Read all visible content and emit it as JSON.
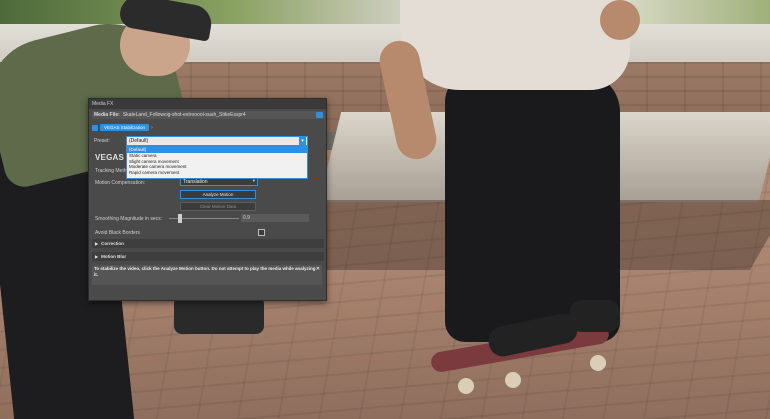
{
  "window": {
    "title": "Media FX",
    "media_file_label": "Media File:",
    "media_file_value": "SkateLand_Followcig-shot-extrooool-suuh_StikeEsspr4",
    "plugin_chain_button": "VEGAS Stabilization",
    "help_icon": "help-icon"
  },
  "preset": {
    "label": "Preset:",
    "selected": "(Default)",
    "options": [
      "(Default)",
      "Static camera",
      "Slight camera movement",
      "Moderate camera movement",
      "Rapid camera movement"
    ]
  },
  "plugin": {
    "logo": "VEGAS V",
    "tracking_label": "Tracking Meth",
    "motion_comp_label": "Motion Compensation:",
    "motion_comp_value": "Translation",
    "analyze_button": "Analyze Motion",
    "clear_button": "Clear Motion Data",
    "smoothing_label": "Smoothing Magnitude in secs:",
    "smoothing_value": "0.9",
    "smoothing_level": 0.15,
    "avoid_label": "Avoid Black Borders",
    "avoid_checked": false
  },
  "sections": {
    "correction": "Correction",
    "motion_blur": "Motion Blur"
  },
  "info": {
    "text": "To stabilize the video, click the Analyze Motion button. Do not attempt to play the media while analyzing it."
  },
  "colors": {
    "accent": "#2f8fe0",
    "panel": "#4a4a4a"
  }
}
